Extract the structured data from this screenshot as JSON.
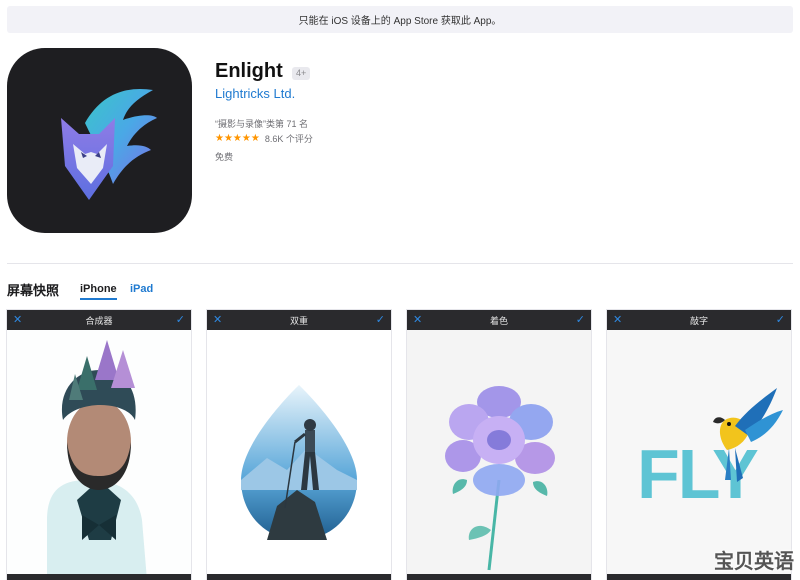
{
  "banner": {
    "text": "只能在 iOS 设备上的 App Store 获取此 App。"
  },
  "app": {
    "name": "Enlight",
    "age_rating": "4+",
    "developer": "Lightricks Ltd.",
    "rank_text": "“摄影与录像”类第 71 名",
    "stars": "★★★★★",
    "rating_text": "8.6K 个评分",
    "price": "免费",
    "icon_name": "fox-leaf-logo-icon",
    "accent_color": "#1f7ad0"
  },
  "screenshots": {
    "title": "屏幕快照",
    "tabs": [
      {
        "label": "iPhone",
        "selected": true
      },
      {
        "label": "iPad",
        "selected": false
      }
    ],
    "items": [
      {
        "title": "合成器",
        "close_icon": "✕",
        "confirm_icon": "✓"
      },
      {
        "title": "双重",
        "close_icon": "✕",
        "confirm_icon": "✓"
      },
      {
        "title": "着色",
        "close_icon": "✕",
        "confirm_icon": "✓"
      },
      {
        "title": "敲字",
        "close_icon": "✕",
        "confirm_icon": "✓",
        "art_text": "FLY"
      }
    ]
  },
  "watermark": {
    "text": "宝贝英语"
  }
}
